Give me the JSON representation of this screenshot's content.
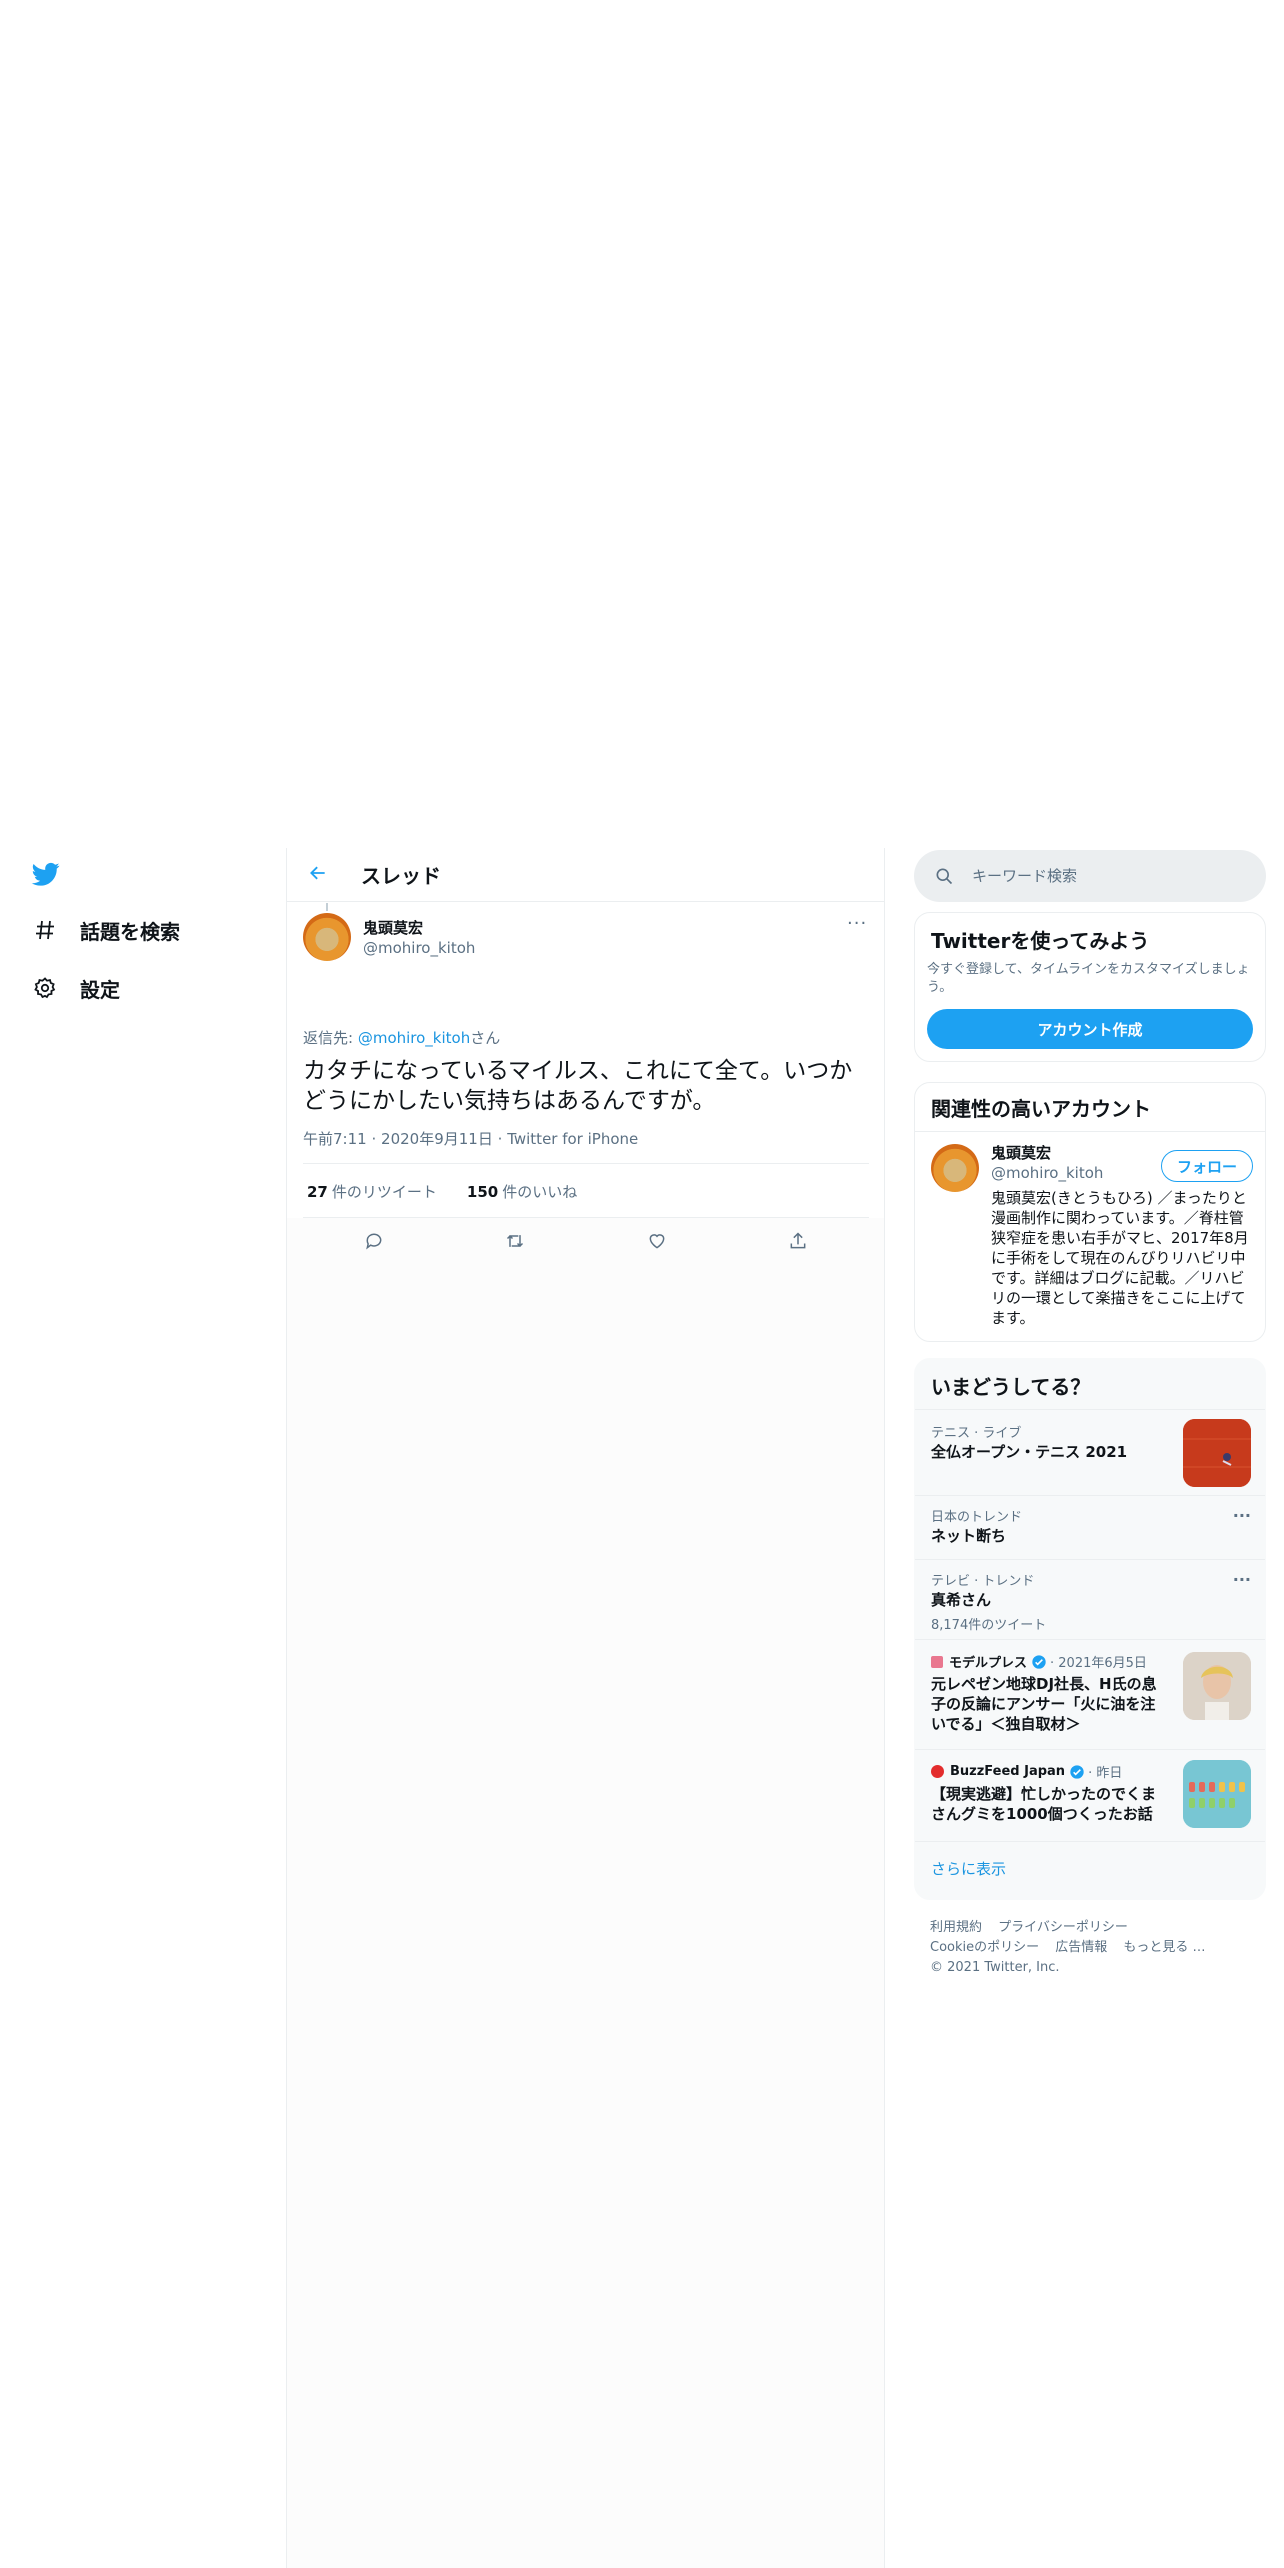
{
  "nav": {
    "logo_icon": "twitter-bird-icon",
    "items": [
      {
        "icon": "hashtag-icon",
        "label": "話題を検索"
      },
      {
        "icon": "gear-icon",
        "label": "設定"
      }
    ]
  },
  "thread": {
    "back_icon": "arrow-left-icon",
    "title": "スレッド"
  },
  "tweet": {
    "author_name": "鬼頭莫宏",
    "author_handle": "@mohiro_kitoh",
    "more_label": "···",
    "reply_prefix": "返信先: ",
    "reply_handle": "@mohiro_kitoh",
    "reply_suffix": "さん",
    "text": "カタチになっているマイルス、これにて全て。いつかどうにかしたい気持ちはあるんですが。",
    "time": "午前7:11",
    "date": "2020年9月11日",
    "sep": "·",
    "client": "Twitter for iPhone",
    "retweet_count": "27",
    "retweet_label": "件のリツイート",
    "like_count": "150",
    "like_label": "件のいいね"
  },
  "search": {
    "placeholder": "キーワード検索"
  },
  "signup": {
    "title": "Twitterを使ってみよう",
    "desc": "今すぐ登録して、タイムラインをカスタマイズしましょう。",
    "button": "アカウント作成"
  },
  "related": {
    "title": "関連性の高いアカウント",
    "name": "鬼頭莫宏",
    "handle": "@mohiro_kitoh",
    "follow": "フォロー",
    "bio": "鬼頭莫宏(きとうもひろ) ／まったりと漫画制作に関わっています。／脊柱管狭窄症を患い右手がマヒ、2017年8月に手術をして現在のんびりリハビリ中です。詳細はブログに記載。／リハビリの一環として楽描きをここに上げてます。"
  },
  "trends": {
    "title": "いまどうしてる？",
    "items": [
      {
        "category": "テニス · ライブ",
        "title": "全仏オープン・テニス 2021"
      },
      {
        "category": "日本のトレンド",
        "title": "ネット断ち"
      },
      {
        "category": "テレビ · トレンド",
        "title": "真希さん",
        "count": "8,174件のツイート"
      },
      {
        "source": "モデルプレス",
        "meta": "· 2021年6月5日",
        "title": "元レペゼン地球DJ社長、H氏の息子の反論にアンサー「火に油を注いでる」＜独自取材＞"
      },
      {
        "source": "BuzzFeed Japan",
        "meta": "· 昨日",
        "title": "【現実逃避】忙しかったのでくまさんグミを1000個つくったお話"
      }
    ],
    "show_more": "さらに表示"
  },
  "footer": {
    "terms": "利用規約",
    "privacy": "プライバシーポリシー",
    "cookie": "Cookieのポリシー",
    "ads": "広告情報",
    "more": "もっと見る …",
    "copyright": "© 2021 Twitter, Inc."
  }
}
